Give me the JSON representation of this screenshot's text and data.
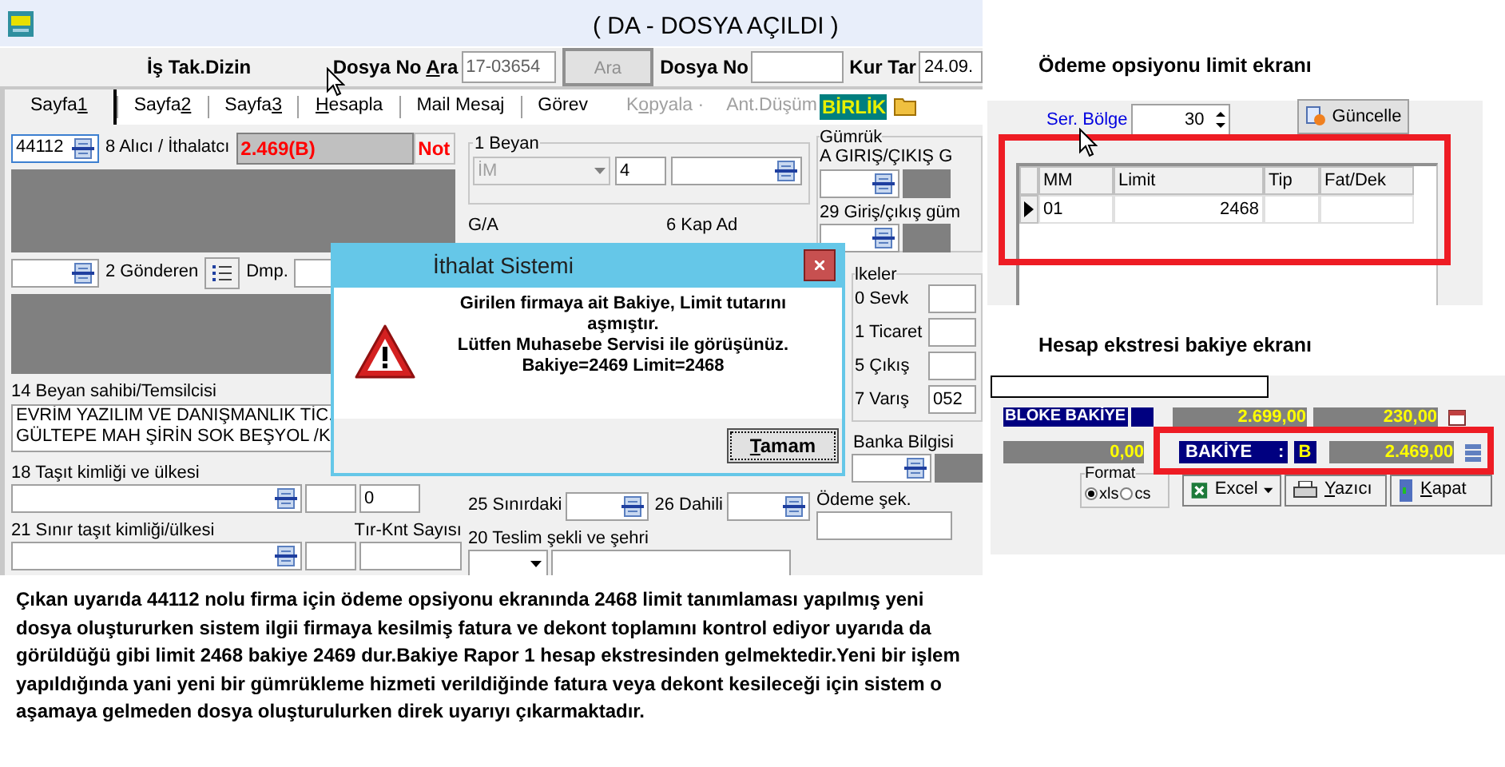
{
  "window": {
    "title": "( DA  - DOSYA AÇILDI )"
  },
  "toolbar": {
    "section_label": "İş Tak.Dizin",
    "search_label": {
      "pre": "Dosya No ",
      "key": "A",
      "post": "ra"
    },
    "search_value": "17-03654",
    "search_button": {
      "label": "Ara",
      "disabled": true
    },
    "file_no_label": "Dosya No",
    "rate_date_label": "Kur Tar",
    "rate_date_value": "24.09."
  },
  "tabs": [
    {
      "pre": "Sayfa ",
      "key": "1",
      "selected": true
    },
    {
      "pre": "Sayfa ",
      "key": "2",
      "selected": false
    },
    {
      "pre": "Sayfa ",
      "key": "3",
      "selected": false
    },
    {
      "key": "H",
      "post": "esapla",
      "selected": false
    },
    {
      "pre": "Mail Mesaj",
      "selected": false
    },
    {
      "pre": "Görev",
      "selected": false
    }
  ],
  "tab_actions": [
    {
      "pre": "K",
      "key": "o",
      "post": "pyala ·",
      "disabled": true
    },
    {
      "pre": "Ant.Düşüm",
      "disabled": true
    }
  ],
  "badge": "BİRLİK",
  "importer": {
    "code": "44112",
    "label": "8 Alıcı / İthalatcı",
    "balance": "2.469(B)",
    "note_button": "Not"
  },
  "sender": {
    "label": "2 Gönderen",
    "dmp_label": "Dmp."
  },
  "declarant": {
    "label": "14 Beyan sahibi/Temsilcisi",
    "lines": [
      "EVRİM YAZILIM VE DANIŞMANLIK TİC.",
      "GÜLTEPE MAH ŞİRİN SOK BEŞYOL /K"
    ]
  },
  "vehicle": {
    "label": "18 Taşıt kimliği ve ülkesi",
    "count_value": "0"
  },
  "border_vehicle": {
    "label": "21 Sınır taşıt kimliği/ülkesi",
    "count_label": "Tır-Knt Sayısı"
  },
  "declaration": {
    "legend": "1 Beyan",
    "type_value": "İM",
    "type_disabled": true,
    "number_value": "4"
  },
  "ga_label": "G/A",
  "package_label": "6 Kap Ad",
  "transport": {
    "border_label": "25 Sınırdaki",
    "inland_label": "26 Dahili"
  },
  "delivery": {
    "label": "20 Teslim şekli ve şehri"
  },
  "customs": {
    "legend": "Gümrük",
    "entry_label": "A GIRIŞ/ÇIKIŞ G",
    "exit_label": "29 Giriş/çıkış güm"
  },
  "countries": {
    "legend": "lkeler",
    "rows": [
      {
        "label": "0 Sevk"
      },
      {
        "label": "1 Ticaret"
      },
      {
        "label": "5 Çıkış"
      },
      {
        "label": "7 Varış",
        "value": "052"
      }
    ]
  },
  "bank": {
    "label": "Banka Bilgisi"
  },
  "payment": {
    "label": "Ödeme şek."
  },
  "dialog": {
    "title": "İthalat Sistemi",
    "lines": [
      "Girilen firmaya ait Bakiye, Limit tutarını aşmıştır.",
      "Lütfen Muhasebe Servisi ile görüşünüz.",
      "Bakiye=2469 Limit=2468"
    ],
    "button": {
      "key": "T",
      "post": "amam"
    }
  },
  "description": "Çıkan uyarıda 44112 nolu firma için ödeme opsiyonu ekranında 2468 limit tanımlaması yapılmış yeni dosya oluştururken sistem ilgii firmaya kesilmiş fatura ve dekont toplamını kontrol ediyor uyarıda da görüldüğü gibi limit 2468 bakiye 2469 dur.Bakiye Rapor 1 hesap ekstresinden gelmektedir.Yeni bir işlem yapıldığında yani yeni bir gümrükleme hizmeti verildiğinde fatura veya dekont kesileceği için sistem o aşamaya gelmeden dosya oluşturulurken direk uyarıyı çıkarmaktadır.",
  "limit_panel": {
    "heading": "Ödeme opsiyonu limit ekranı",
    "region_label": "Ser. Bölge",
    "region_value": "30",
    "update_button": "Güncelle",
    "columns": [
      "MM",
      "Limit",
      "Tip",
      "Fat/Dek"
    ],
    "rows": [
      {
        "selected": true,
        "cells": [
          "01",
          "2468"
        ]
      }
    ]
  },
  "balance_panel": {
    "heading": "Hesap ekstresi bakiye ekranı",
    "blocked_label": "BLOKE BAKİYE",
    "totals": [
      "2.699,00",
      "230,00"
    ],
    "blocked_value": "0,00",
    "balance_label": "BAKİYE",
    "balance_sep": ":",
    "balance_type": "B",
    "balance_value": "2.469,00",
    "format": {
      "legend": "Format",
      "options": [
        {
          "label": "xls",
          "selected": true
        },
        {
          "label": "cs",
          "selected": false
        }
      ]
    },
    "buttons": [
      {
        "kind": "excel",
        "pre": "Excel"
      },
      {
        "kind": "print",
        "key": "Y",
        "post": "azıcı"
      },
      {
        "kind": "close",
        "key": "K",
        "post": "apat"
      }
    ]
  }
}
